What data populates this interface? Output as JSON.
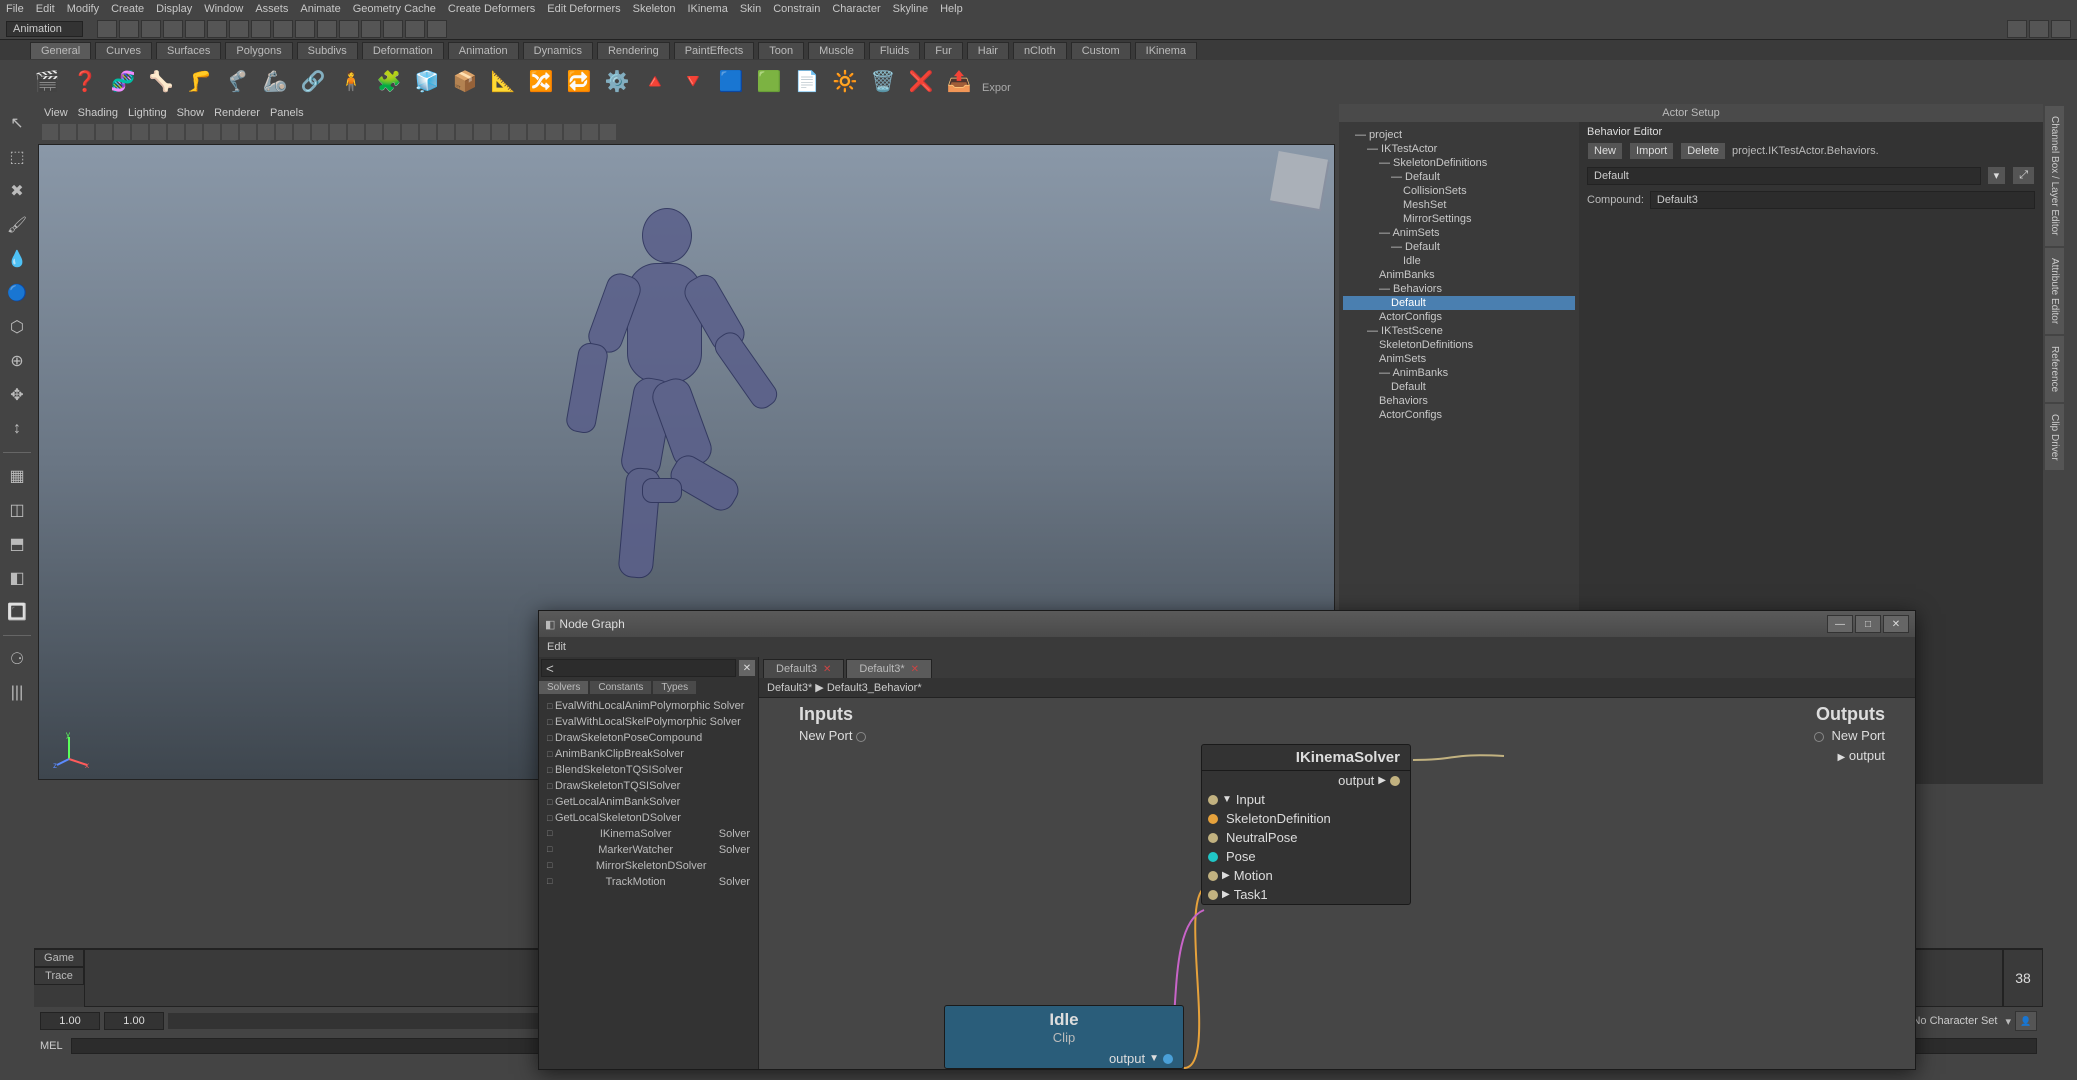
{
  "menubar": [
    "File",
    "Edit",
    "Modify",
    "Create",
    "Display",
    "Window",
    "Assets",
    "Animate",
    "Geometry Cache",
    "Create Deformers",
    "Edit Deformers",
    "Skeleton",
    "IKinema",
    "Skin",
    "Constrain",
    "Character",
    "Skyline",
    "Help"
  ],
  "status_row": {
    "dropdown": "Animation"
  },
  "shelf_tabs": [
    "General",
    "Curves",
    "Surfaces",
    "Polygons",
    "Subdivs",
    "Deformation",
    "Animation",
    "Dynamics",
    "Rendering",
    "PaintEffects",
    "Toon",
    "Muscle",
    "Fluids",
    "Fur",
    "Hair",
    "nCloth",
    "Custom",
    "IKinema"
  ],
  "active_shelf_tab": "General",
  "shelf_export_label": "Expor",
  "viewport_menu": [
    "View",
    "Shading",
    "Lighting",
    "Show",
    "Renderer",
    "Panels"
  ],
  "right_tabs": [
    "Channel Box / Layer Editor",
    "Attribute Editor",
    "Reference",
    "Clip Driver"
  ],
  "actor_setup": {
    "header": "Actor Setup",
    "tree": [
      {
        "label": "— project",
        "indent": 1
      },
      {
        "label": "— IKTestActor",
        "indent": 2
      },
      {
        "label": "— SkeletonDefinitions",
        "indent": 3
      },
      {
        "label": "— Default",
        "indent": 4
      },
      {
        "label": "CollisionSets",
        "indent": 5
      },
      {
        "label": "MeshSet",
        "indent": 5
      },
      {
        "label": "MirrorSettings",
        "indent": 5
      },
      {
        "label": "— AnimSets",
        "indent": 3
      },
      {
        "label": "— Default",
        "indent": 4
      },
      {
        "label": "Idle",
        "indent": 5
      },
      {
        "label": "AnimBanks",
        "indent": 3
      },
      {
        "label": "— Behaviors",
        "indent": 3
      },
      {
        "label": "Default",
        "indent": 4,
        "selected": true
      },
      {
        "label": "ActorConfigs",
        "indent": 3
      },
      {
        "label": "— IKTestScene",
        "indent": 2
      },
      {
        "label": "SkeletonDefinitions",
        "indent": 3
      },
      {
        "label": "AnimSets",
        "indent": 3
      },
      {
        "label": "— AnimBanks",
        "indent": 3
      },
      {
        "label": "Default",
        "indent": 4
      },
      {
        "label": "Behaviors",
        "indent": 3
      },
      {
        "label": "ActorConfigs",
        "indent": 3
      }
    ],
    "behavior_editor": {
      "title": "Behavior Editor",
      "buttons": [
        "New",
        "Import",
        "Delete"
      ],
      "path_label": "project.IKTestActor.Behaviors.",
      "path_value": "Default",
      "compound_label": "Compound:",
      "compound_value": "Default3"
    }
  },
  "timeline": {
    "left_labels": [
      "Game",
      "Trace"
    ],
    "start_frame": "1.00",
    "current_frame": "1.00",
    "end_frame": "38",
    "char_set_label": "No Character Set",
    "mel_label": "MEL"
  },
  "node_graph": {
    "window_title": "Node Graph",
    "menu": "Edit",
    "search_value": "<",
    "small_tabs": [
      "Solvers",
      "Constants",
      "Types"
    ],
    "active_small_tab": "Solvers",
    "solver_list_simple": [
      "EvalWithLocalAnimPolymorphic Solver",
      "EvalWithLocalSkelPolymorphic Solver",
      "DrawSkeletonPoseCompound",
      "AnimBankClipBreakSolver",
      "BlendSkeletonTQSISolver",
      "DrawSkeletonTQSISolver",
      "GetLocalAnimBankSolver",
      "GetLocalSkeletonDSolver"
    ],
    "solver_list_twocol": [
      {
        "l": "IKinemaSolver",
        "r": "Solver"
      },
      {
        "l": "MarkerWatcher",
        "r": "Solver"
      },
      {
        "l": "MirrorSkeletonDSolver",
        "r": ""
      },
      {
        "l": "TrackMotion",
        "r": "Solver"
      }
    ],
    "tabs": [
      {
        "label": "Default3",
        "active": false,
        "close": true
      },
      {
        "label": "Default3*",
        "active": true,
        "close": true
      }
    ],
    "breadcrumb": "Default3* ▶ Default3_Behavior*",
    "inputs_label": "Inputs",
    "outputs_label": "Outputs",
    "new_port_label": "New Port",
    "output_port_label": "output",
    "idle_node": {
      "title": "Idle",
      "subtitle": "Clip",
      "out_port": "output"
    },
    "solver_node": {
      "title": "IKinemaSolver",
      "out_port": "output",
      "ports": [
        {
          "label": "Input",
          "expand": "▼",
          "color": "#c2b280"
        },
        {
          "label": "SkeletonDefinition",
          "expand": "",
          "color": "#e6a23c"
        },
        {
          "label": "NeutralPose",
          "expand": "",
          "color": "#c2b280"
        },
        {
          "label": "Pose",
          "expand": "",
          "color": "#20c6c6"
        },
        {
          "label": "Motion",
          "expand": "▶",
          "color": "#c2b280"
        },
        {
          "label": "Task1",
          "expand": "▶",
          "color": "#c2b280"
        }
      ]
    }
  }
}
